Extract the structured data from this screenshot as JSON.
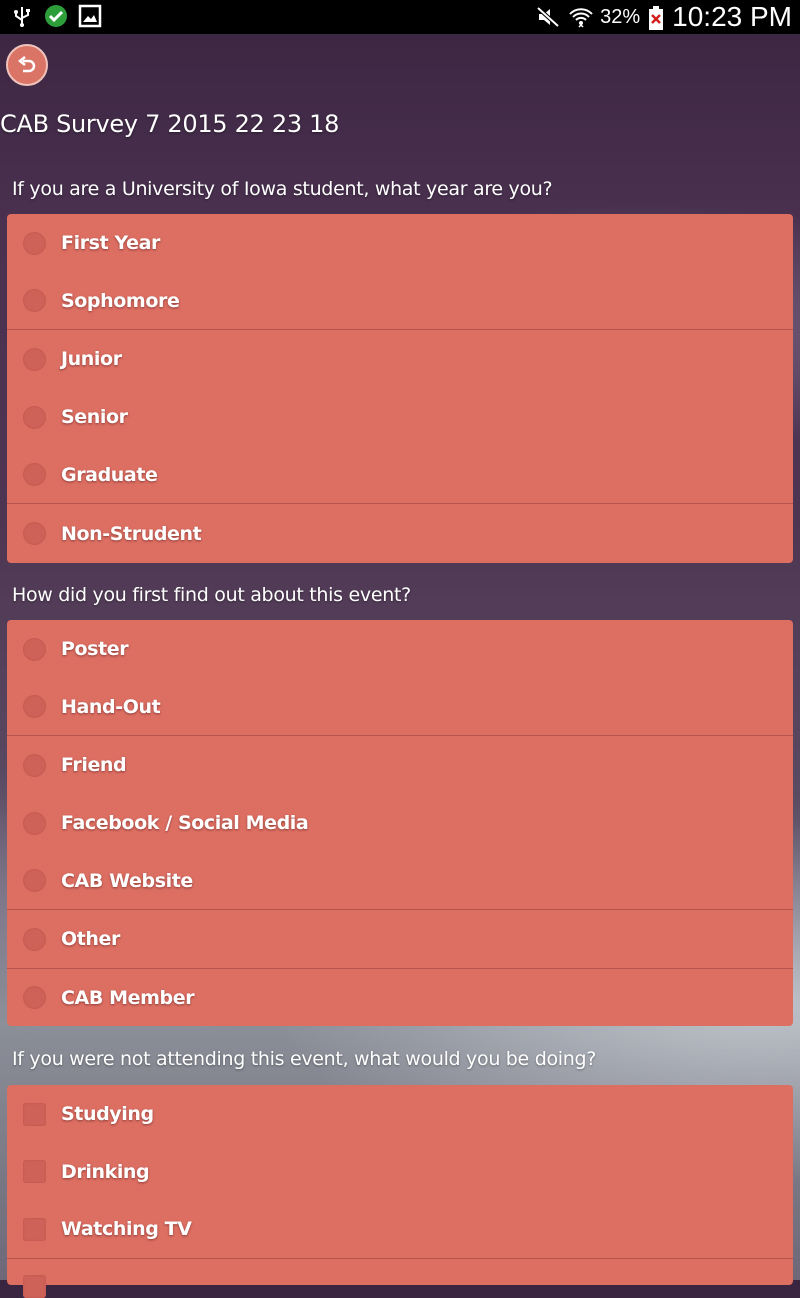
{
  "status_bar": {
    "left_icons": [
      "usb-icon",
      "check-circle-icon",
      "image-icon"
    ],
    "right_icons": [
      "mute-icon",
      "wifi-icon",
      "battery-icon"
    ],
    "battery_text": "32%",
    "time": "10:23 PM"
  },
  "header": {
    "back_icon": "undo-icon",
    "title": "CAB Survey 7 2015 22 23 18"
  },
  "colors": {
    "card": "#dc6e62",
    "status_bar": "#000000"
  },
  "questions": [
    {
      "text": "If you are a University of Iowa student, what year are you?",
      "type": "radio",
      "options": [
        "First Year",
        "Sophomore",
        "Junior",
        "Senior",
        "Graduate",
        "Non-Strudent"
      ]
    },
    {
      "text": "How did you first find out about this event?",
      "type": "radio",
      "options": [
        "Poster",
        "Hand-Out",
        "Friend",
        "Facebook / Social Media",
        "CAB Website",
        "Other",
        "CAB Member"
      ]
    },
    {
      "text": "If you were not attending this event, what would you be doing?",
      "type": "checkbox",
      "options": [
        "Studying",
        "Drinking",
        "Watching TV"
      ]
    }
  ]
}
